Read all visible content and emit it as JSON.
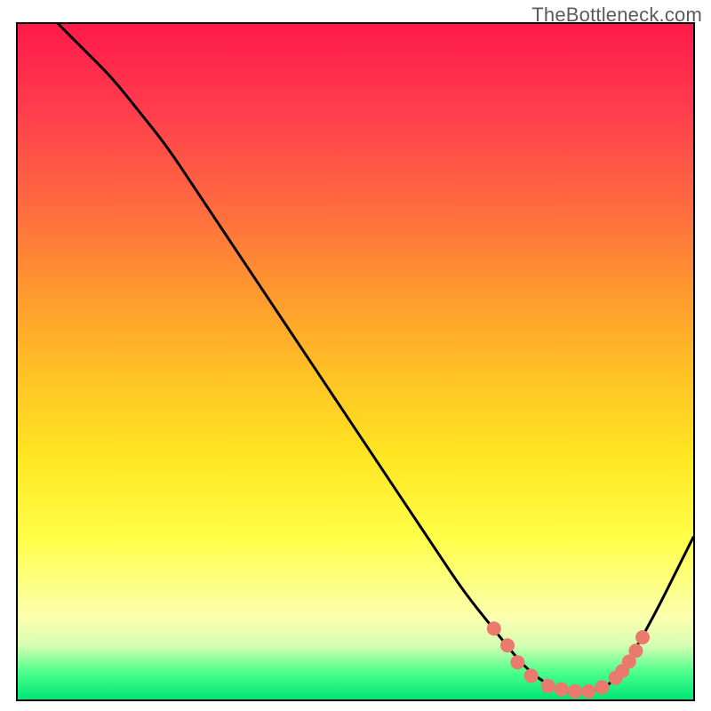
{
  "watermark": "TheBottleneck.com",
  "chart_data": {
    "type": "line",
    "title": "",
    "xlabel": "",
    "ylabel": "",
    "xlim": [
      0,
      100
    ],
    "ylim": [
      0,
      100
    ],
    "grid": false,
    "legend": false,
    "series": [
      {
        "name": "bottleneck-curve",
        "color": "#000000",
        "x": [
          6,
          10,
          14,
          18,
          22,
          26,
          30,
          34,
          38,
          42,
          46,
          50,
          54,
          58,
          62,
          66,
          70,
          74,
          76,
          78,
          80,
          82,
          84,
          86,
          88,
          90,
          94,
          98,
          100
        ],
        "y": [
          100,
          96,
          92,
          87,
          82,
          76,
          70,
          64,
          58,
          52,
          46,
          40,
          34,
          28,
          22,
          16,
          11,
          6,
          4,
          2.5,
          1.5,
          1,
          1,
          1.5,
          2.5,
          5,
          12,
          20,
          24
        ]
      }
    ],
    "markers": [
      {
        "name": "valley-dots",
        "color": "#e97a6d",
        "radius_px": 8,
        "points": [
          {
            "x": 70.5,
            "y": 10.5
          },
          {
            "x": 72.5,
            "y": 8.0
          },
          {
            "x": 74.0,
            "y": 5.5
          },
          {
            "x": 76.0,
            "y": 3.5
          },
          {
            "x": 78.5,
            "y": 2.0
          },
          {
            "x": 80.5,
            "y": 1.5
          },
          {
            "x": 82.5,
            "y": 1.2
          },
          {
            "x": 84.5,
            "y": 1.2
          },
          {
            "x": 86.5,
            "y": 1.8
          },
          {
            "x": 88.5,
            "y": 3.2
          },
          {
            "x": 89.5,
            "y": 4.2
          },
          {
            "x": 90.5,
            "y": 5.6
          },
          {
            "x": 91.5,
            "y": 7.2
          },
          {
            "x": 92.5,
            "y": 9.2
          }
        ]
      }
    ]
  }
}
